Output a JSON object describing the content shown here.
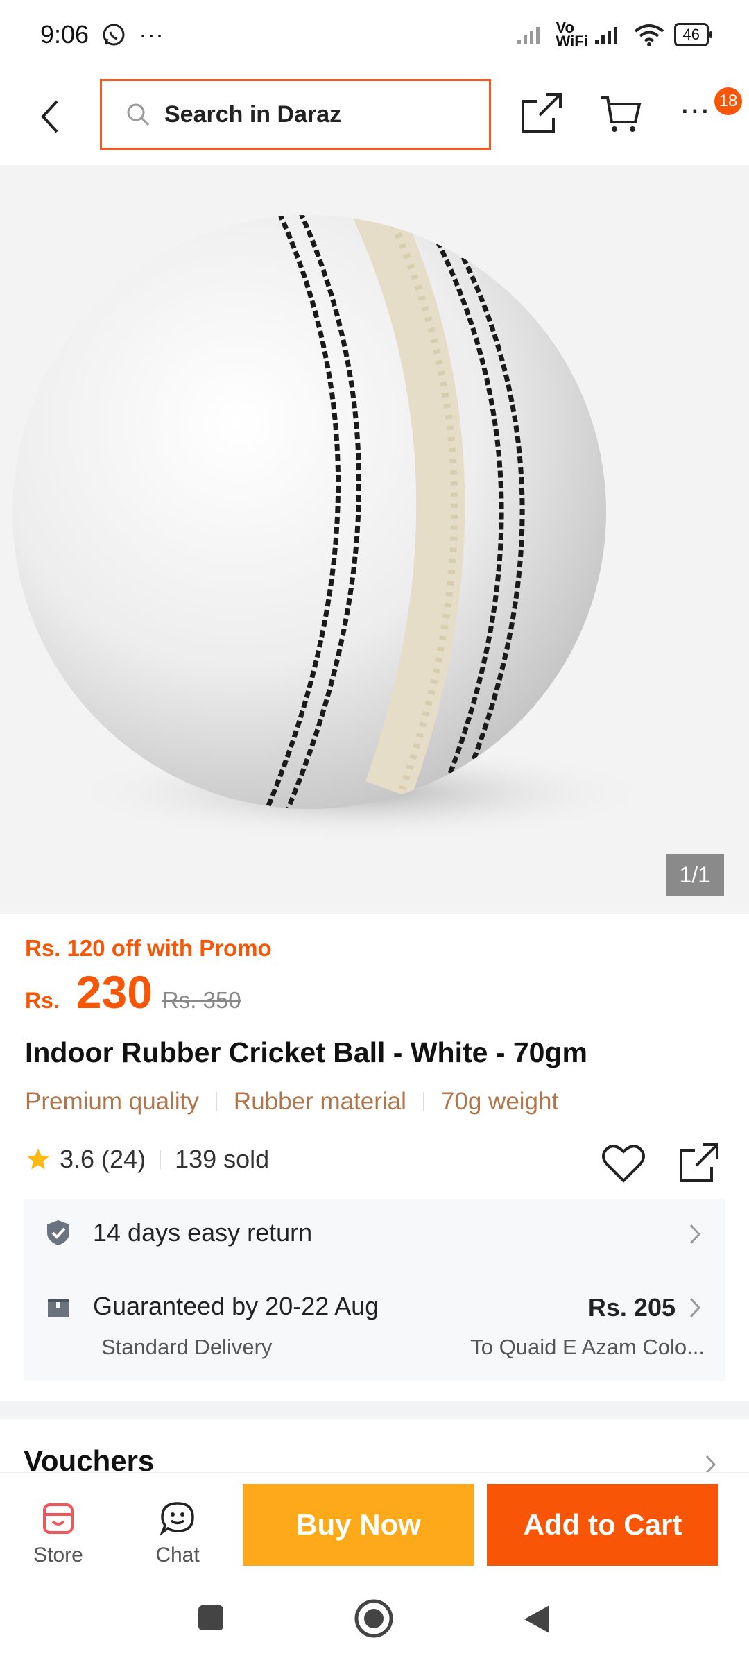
{
  "status_bar": {
    "time": "9:06",
    "dots": "···",
    "network_label": "Vo WiFi",
    "battery": "46"
  },
  "header": {
    "search_placeholder": "Search in Daraz",
    "more_badge": "18"
  },
  "gallery": {
    "counter": "1/1"
  },
  "product": {
    "promo": "Rs. 120 off with Promo",
    "currency": "Rs.",
    "price": "230",
    "original_price": "Rs. 350",
    "title": "Indoor Rubber Cricket Ball - White - 70gm",
    "tags": [
      "Premium quality",
      "Rubber material",
      "70g weight"
    ],
    "rating": "3.6",
    "reviews": "(24)",
    "sold": "139 sold"
  },
  "service": {
    "return_text": "14 days easy return",
    "delivery_text": "Guaranteed by 20-22 Aug",
    "delivery_type": "Standard Delivery",
    "delivery_fee": "Rs. 205",
    "destination": "To Quaid E Azam Colo..."
  },
  "vouchers_label": "Vouchers",
  "actions": {
    "store": "Store",
    "chat": "Chat",
    "buy_now": "Buy Now",
    "add_to_cart": "Add to Cart"
  },
  "colors": {
    "accent": "#f85606",
    "buy_now": "#fda91a",
    "tag_text": "#b0754a"
  }
}
